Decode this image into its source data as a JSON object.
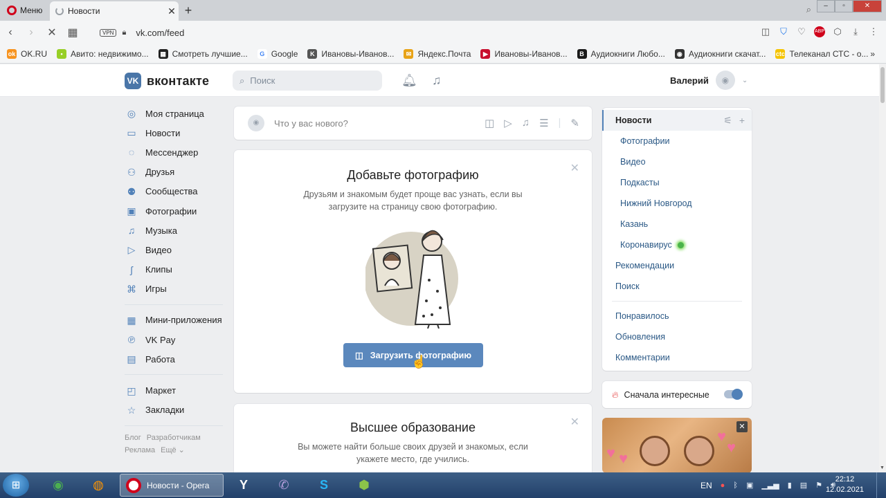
{
  "browser": {
    "menu_label": "Меню",
    "tab_title": "Новости",
    "tab_close": "✕",
    "new_tab": "+",
    "vpn": "VPN",
    "url": "vk.com/feed",
    "abp_badge": "ABP",
    "bookmarks": [
      {
        "label": "OK.RU",
        "color": "#f7931e",
        "glyph": "ok"
      },
      {
        "label": "Авито: недвижимо...",
        "color": "#97cf26",
        "glyph": "•"
      },
      {
        "label": "Смотреть лучшие...",
        "color": "#222222",
        "glyph": "▦"
      },
      {
        "label": "Google",
        "color": "#ffffff",
        "glyph": "G"
      },
      {
        "label": "Ивановы-Иванов...",
        "color": "#555555",
        "glyph": "K"
      },
      {
        "label": "Яндекс.Почта",
        "color": "#e8a317",
        "glyph": "✉"
      },
      {
        "label": "Ивановы-Иванов...",
        "color": "#c8102e",
        "glyph": "▶"
      },
      {
        "label": "Аудиокниги Любо...",
        "color": "#1a1a1a",
        "glyph": "B"
      },
      {
        "label": "Аудиокниги скачат...",
        "color": "#333333",
        "glyph": "◉"
      },
      {
        "label": "Телеканал СТС - о...",
        "color": "#f5c400",
        "glyph": "ctc"
      }
    ],
    "bookmarks_more": "»"
  },
  "vk": {
    "logo_text": "вконтакте",
    "search_placeholder": "Поиск",
    "user_name": "Валерий",
    "nav": [
      {
        "label": "Моя страница",
        "icon": "user-circle-icon",
        "glyph": "◎"
      },
      {
        "label": "Новости",
        "icon": "news-icon",
        "glyph": "▭"
      },
      {
        "label": "Мессенджер",
        "icon": "message-icon",
        "glyph": "◌"
      },
      {
        "label": "Друзья",
        "icon": "friends-icon",
        "glyph": "⚇"
      },
      {
        "label": "Сообщества",
        "icon": "communities-icon",
        "glyph": "⚉"
      },
      {
        "label": "Фотографии",
        "icon": "photo-icon",
        "glyph": "▣"
      },
      {
        "label": "Музыка",
        "icon": "music-icon",
        "glyph": "♫"
      },
      {
        "label": "Видео",
        "icon": "video-icon",
        "glyph": "▷"
      },
      {
        "label": "Клипы",
        "icon": "clips-icon",
        "glyph": "ʃ"
      },
      {
        "label": "Игры",
        "icon": "games-icon",
        "glyph": "⌘"
      }
    ],
    "nav2": [
      {
        "label": "Мини-приложения",
        "icon": "apps-icon",
        "glyph": "▦"
      },
      {
        "label": "VK Pay",
        "icon": "vkpay-icon",
        "glyph": "℗"
      },
      {
        "label": "Работа",
        "icon": "work-icon",
        "glyph": "▤"
      }
    ],
    "nav3": [
      {
        "label": "Маркет",
        "icon": "market-icon",
        "glyph": "◰"
      },
      {
        "label": "Закладки",
        "icon": "bookmarks-icon",
        "glyph": "☆"
      }
    ],
    "footer": {
      "blog": "Блог",
      "dev": "Разработчикам",
      "ads": "Реклама",
      "more": "Ещё ⌄"
    },
    "post_placeholder": "Что у вас нового?",
    "photo_card": {
      "title": "Добавьте фотографию",
      "text": "Друзьям и знакомым будет проще вас узнать, если вы загрузите на страницу свою фотографию.",
      "button": "Загрузить фотографию"
    },
    "edu_card": {
      "title": "Высшее образование",
      "text": "Вы можете найти больше своих друзей и знакомых, если укажете место, где учились."
    },
    "right_menu": {
      "active": "Новости",
      "subs": [
        "Фотографии",
        "Видео",
        "Подкасты",
        "Нижний Новгород",
        "Казань",
        "Коронавирус"
      ],
      "items": [
        "Рекомендации",
        "Поиск"
      ],
      "items2": [
        "Понравилось",
        "Обновления",
        "Комментарии"
      ]
    },
    "toggle_label": "Сначала интересные",
    "toggle_on": true
  },
  "taskbar": {
    "active_app": "Новости - Opera",
    "lang": "EN",
    "time": "22:12",
    "date": "12.02.2021"
  }
}
